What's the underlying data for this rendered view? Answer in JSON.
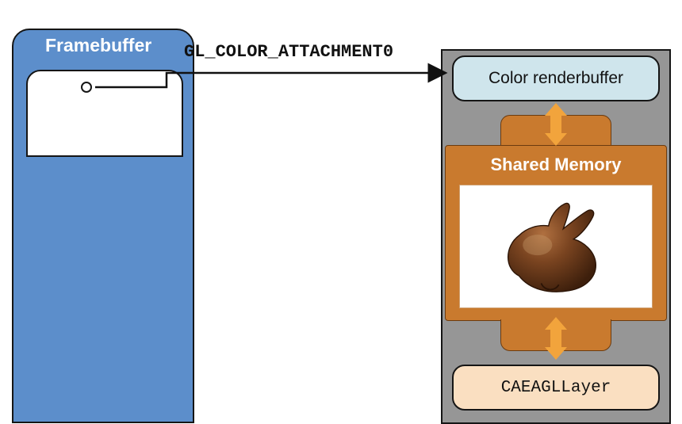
{
  "framebuffer": {
    "title": "Framebuffer"
  },
  "connector": {
    "label": "GL_COLOR_ATTACHMENT0"
  },
  "renderbuffer": {
    "label": "Color renderbuffer"
  },
  "shared_memory": {
    "title": "Shared Memory",
    "content_icon": "bunny-3d-model"
  },
  "caeagl_layer": {
    "label": "CAEAGLLayer"
  },
  "colors": {
    "framebuffer_blue": "#5C8ECB",
    "shared_memory_orange": "#C97A2E",
    "arrow_orange": "#F2A43C",
    "renderbuffer_bg": "#CFE5EC",
    "caeagl_bg": "#FADFC1",
    "panel_gray": "#969696"
  }
}
